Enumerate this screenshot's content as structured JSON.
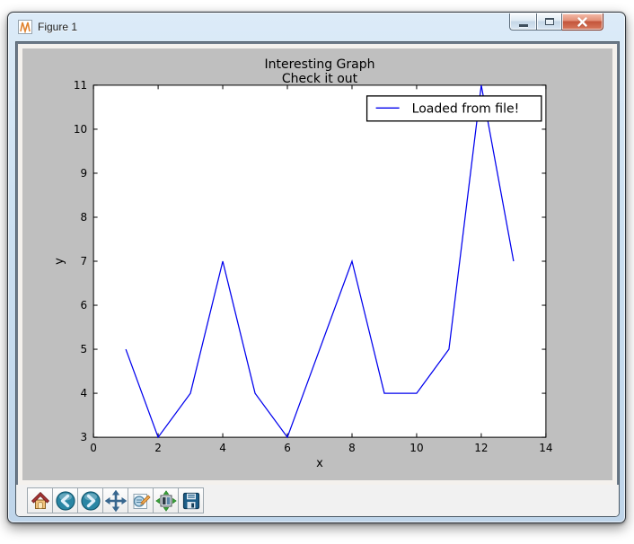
{
  "window": {
    "title": "Figure 1",
    "caption_buttons": [
      {
        "name": "minimize"
      },
      {
        "name": "maximize"
      },
      {
        "name": "close"
      }
    ]
  },
  "toolbar": {
    "buttons": [
      {
        "id": "home",
        "icon": "home-icon"
      },
      {
        "id": "back",
        "icon": "back-arrow-icon"
      },
      {
        "id": "forward",
        "icon": "forward-arrow-icon"
      },
      {
        "id": "pan",
        "icon": "pan-arrows-icon"
      },
      {
        "id": "zoom",
        "icon": "zoom-to-rect-icon"
      },
      {
        "id": "subplots",
        "icon": "configure-subplots-icon"
      },
      {
        "id": "save",
        "icon": "save-floppy-icon"
      }
    ]
  },
  "chart_data": {
    "type": "line",
    "title": "Interesting Graph",
    "subtitle": "Check it out",
    "xlabel": "x",
    "ylabel": "y",
    "x": [
      1,
      2,
      3,
      4,
      5,
      6,
      7,
      8,
      9,
      10,
      11,
      12,
      13
    ],
    "y": [
      5,
      3,
      4,
      7,
      4,
      3,
      5,
      7,
      4,
      4,
      5,
      11,
      7
    ],
    "xlim": [
      0,
      14
    ],
    "ylim": [
      3,
      11
    ],
    "xticks": [
      0,
      2,
      4,
      6,
      8,
      10,
      12,
      14
    ],
    "yticks": [
      3,
      4,
      5,
      6,
      7,
      8,
      9,
      10,
      11
    ],
    "grid": false,
    "legend": {
      "label": "Loaded from file!",
      "position": "upper right"
    },
    "line_color": "#0000ee",
    "figure_bg": "#bfbfbf",
    "plot_bg": "#ffffff"
  },
  "colors": {
    "frame_blue": "#cde1f2",
    "close_button_red": "#c4553b",
    "toolbar_teal": "#2a86a4",
    "toolbar_steel_blue": "#38678f"
  }
}
